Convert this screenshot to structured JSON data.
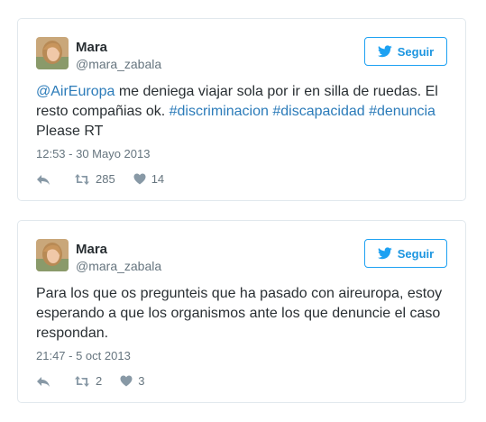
{
  "tweets": [
    {
      "name": "Mara",
      "handle": "@mara_zabala",
      "follow_label": "Seguir",
      "text_parts": {
        "mention": "@AirEuropa",
        "t1": " me deniega viajar sola por ir en silla de ruedas. El resto compañias ok. ",
        "h1": "#discriminacion",
        "s1": " ",
        "h2": "#discapacidad",
        "s2": " ",
        "h3": "#denuncia",
        "t2": " Please RT"
      },
      "timestamp": "12:53 - 30 Mayo 2013",
      "retweets": "285",
      "likes": "14"
    },
    {
      "name": "Mara",
      "handle": "@mara_zabala",
      "follow_label": "Seguir",
      "text": "Para los que os pregunteis que ha pasado con aireuropa, estoy esperando a que los organismos ante los que denuncie el caso respondan.",
      "timestamp": "21:47 - 5 oct 2013",
      "retweets": "2",
      "likes": "3"
    }
  ],
  "colors": {
    "accent": "#1da1f2",
    "link": "#2b7bb9",
    "muted": "#66757f",
    "text": "#292f33",
    "border": "#e1e8ed"
  },
  "icons": {
    "reply": "reply-icon",
    "retweet": "retweet-icon",
    "like": "heart-icon",
    "follow": "twitter-bird-icon"
  }
}
